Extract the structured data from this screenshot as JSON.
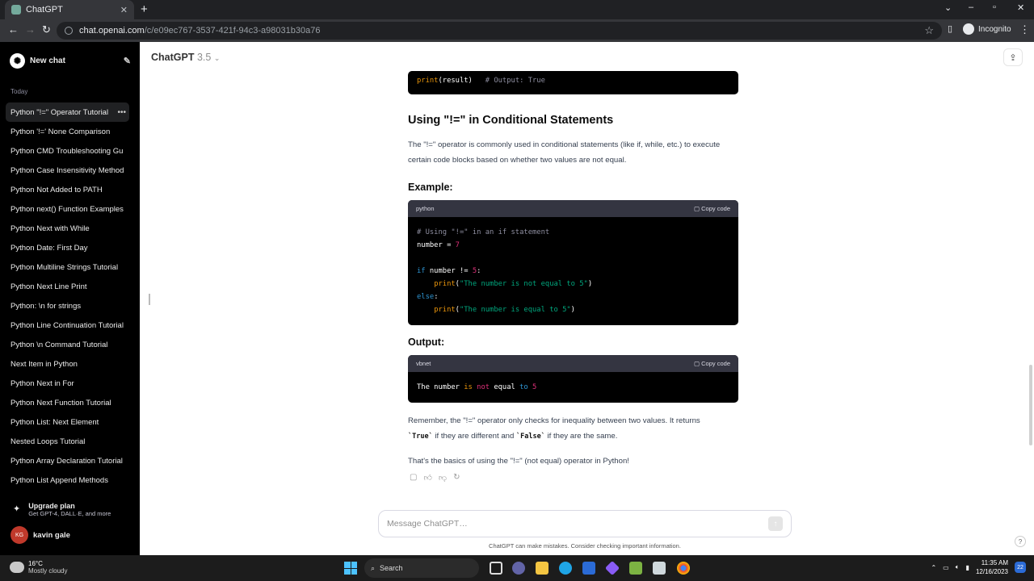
{
  "browser": {
    "tab_title": "ChatGPT",
    "url_host": "chat.openai.com",
    "url_path": "/c/e09ec767-3537-421f-94c3-a98031b30a76",
    "incognito_label": "Incognito"
  },
  "sidebar": {
    "new_chat": "New chat",
    "section_today": "Today",
    "items": [
      "Python \"!=\" Operator Tutorial",
      "Python '!=' None Comparison",
      "Python CMD Troubleshooting Gu",
      "Python Case Insensitivity Method",
      "Python Not Added to PATH",
      "Python next() Function Examples",
      "Python Next with While",
      "Python Date: First Day",
      "Python Multiline Strings Tutorial",
      "Python Next Line Print",
      "Python: \\n for strings",
      "Python Line Continuation Tutorial",
      "Python \\n Command Tutorial",
      "Next Item in Python",
      "Python Next in For",
      "Python Next Function Tutorial",
      "Python List: Next Element",
      "Nested Loops Tutorial",
      "Python Array Declaration Tutorial",
      "Python List Append Methods"
    ],
    "upgrade_title": "Upgrade plan",
    "upgrade_sub": "Get GPT-4, DALL·E, and more",
    "user_initials": "KG",
    "user_name": "kavin gale"
  },
  "header": {
    "model": "ChatGPT",
    "version": "3.5"
  },
  "message": {
    "top_code_line_fn": "print",
    "top_code_line_rest": "(result)",
    "top_code_line_comment": "# Output: True",
    "heading": "Using \"!=\" in Conditional Statements",
    "para1": "The \"!=\" operator is commonly used in conditional statements (like if, while, etc.) to execute certain code blocks based on whether two values are not equal.",
    "example_label": "Example:",
    "code1_lang": "python",
    "copy_label": "Copy code",
    "code1": {
      "comment": "# Using \"!=\" in an if statement",
      "l2_var": "number",
      "l2_eq": " = ",
      "l2_num": "7",
      "l4_if": "if",
      "l4_mid": " number != ",
      "l4_num": "5",
      "l4_end": ":",
      "l5_fn": "print",
      "l5_str": "\"The number is not equal to 5\"",
      "l6_else": "else",
      "l6_end": ":",
      "l7_fn": "print",
      "l7_str": "\"The number is equal to 5\""
    },
    "output_label": "Output:",
    "code2_lang": "vbnet",
    "code2": {
      "w1": "The number ",
      "w2": "is",
      "w3": " ",
      "w4": "not",
      "w5": " equal ",
      "w6": "to",
      "w7": " ",
      "w8": "5"
    },
    "para2_a": "Remember, the \"!=\" operator only checks for inequality between two values. It returns",
    "para2_true": "`True`",
    "para2_b": " if they are different and ",
    "para2_false": "`False`",
    "para2_c": " if they are the same.",
    "para3": "That's the basics of using the \"!=\" (not equal) operator in Python!"
  },
  "composer": {
    "placeholder": "Message ChatGPT…",
    "disclaimer": "ChatGPT can make mistakes. Consider checking important information."
  },
  "taskbar": {
    "temp": "16°C",
    "weather": "Mostly cloudy",
    "search": "Search",
    "time": "11:35 AM",
    "date": "12/16/2023",
    "notif_count": "22"
  }
}
